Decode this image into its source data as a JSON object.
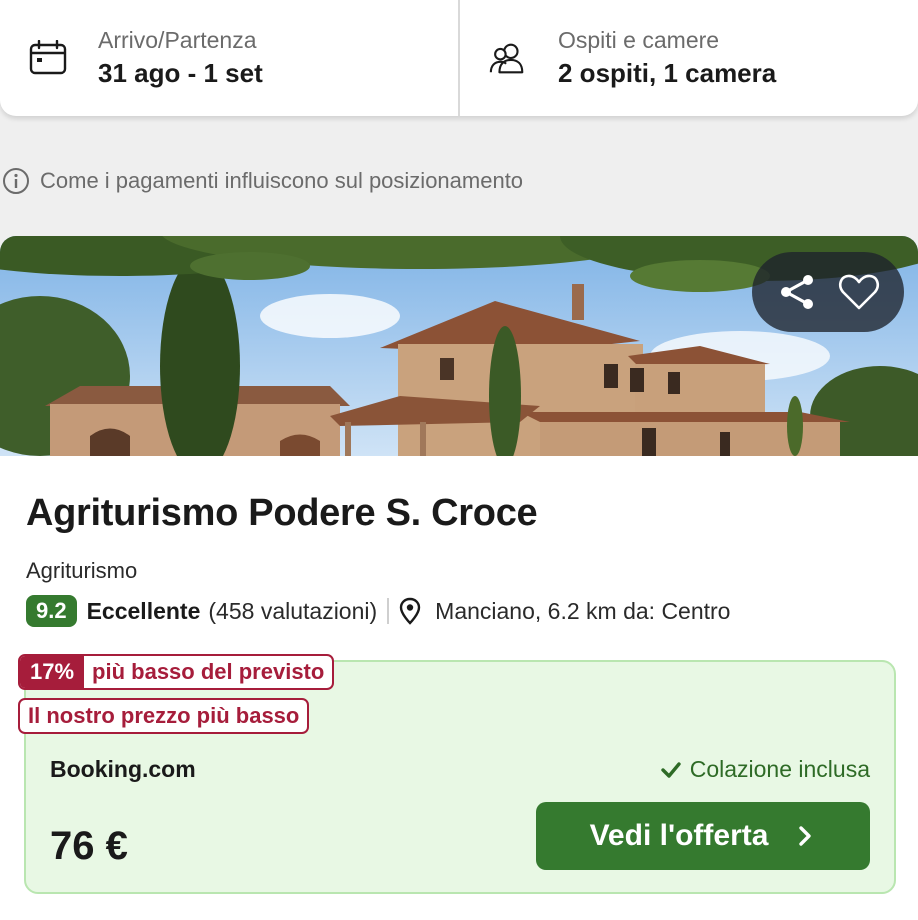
{
  "search": {
    "dates_label": "Arrivo/Partenza",
    "dates_value": "31 ago - 1 set",
    "guests_label": "Ospiti e camere",
    "guests_value": "2 ospiti, 1 camera"
  },
  "payment_info": "Come i pagamenti influiscono sul posizionamento",
  "hotel": {
    "name": "Agriturismo Podere S. Croce",
    "type": "Agriturismo",
    "score": "9.2",
    "rating_label": "Eccellente",
    "rating_count": "(458 valutazioni)",
    "location": "Manciano, 6.2 km da: Centro"
  },
  "offer": {
    "discount_pct": "17%",
    "discount_text": "più basso del previsto",
    "badge_lowest": "Il nostro prezzo più basso",
    "provider": "Booking.com",
    "breakfast": "Colazione inclusa",
    "price": "76 €",
    "cta_label": "Vedi l'offerta"
  },
  "icons": {
    "calendar": "calendar-icon",
    "guests": "guests-icon",
    "info": "info-icon",
    "share": "share-icon",
    "favorite": "heart-icon",
    "location": "location-pin-icon",
    "check": "check-icon",
    "chevron": "chevron-right-icon"
  },
  "colors": {
    "score_green": "#357a2f",
    "discount_red": "#a61d3b",
    "offer_bg": "#e8f8e4",
    "cta_green": "#357a2f"
  }
}
